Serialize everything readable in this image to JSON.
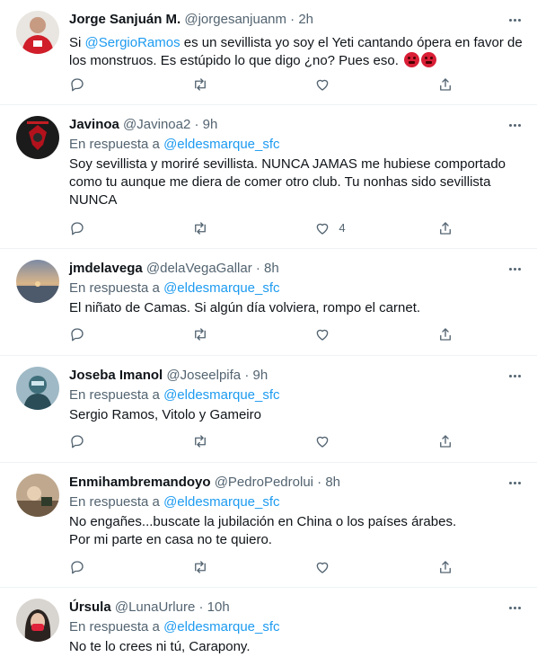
{
  "tweets": [
    {
      "name": "Jorge Sanjuán M.",
      "handle": "@jorgesanjuanm",
      "time": "2h",
      "mention": "@SergioRamos",
      "text": " es un sevillista yo soy el Yeti cantando ópera en favor de los monstruos. Es estúpido lo que digo ¿no? Pues eso. ",
      "text_prefix": "Si ",
      "emojis": [
        "angry-face-icon",
        "cursing-face-icon"
      ],
      "likes": ""
    },
    {
      "name": "Javinoa",
      "handle": "@Javinoa2",
      "time": "9h",
      "replying_label": "En respuesta a",
      "replying_to": "@eldesmarque_sfc",
      "text": "Soy sevillista y moriré sevillista.  NUNCA JAMAS me hubiese comportado como tu aunque me diera de comer otro club.  Tu nonhas sido sevillista NUNCA",
      "likes": "4"
    },
    {
      "name": "jmdelavega",
      "handle": "@delaVegaGallar",
      "time": "8h",
      "replying_label": "En respuesta a",
      "replying_to": "@eldesmarque_sfc",
      "text": "El niñato de Camas. Si algún día volviera, rompo el carnet.",
      "likes": ""
    },
    {
      "name": "Joseba Imanol",
      "handle": "@Joseelpifa",
      "time": "9h",
      "replying_label": "En respuesta a",
      "replying_to": "@eldesmarque_sfc",
      "text": "Sergio Ramos, Vitolo y Gameiro",
      "likes": ""
    },
    {
      "name": "Enmihambremandoyo",
      "handle": "@PedroPedrolui",
      "time": "8h",
      "replying_label": "En respuesta a",
      "replying_to": "@eldesmarque_sfc",
      "text": "No engañes...buscate la jubilación en China o los países árabes.\nPor mi parte en casa no te quiero.",
      "likes": ""
    },
    {
      "name": "Úrsula",
      "handle": "@LunaUrlure",
      "time": "10h",
      "replying_label": "En respuesta a",
      "replying_to": "@eldesmarque_sfc",
      "text": "No te lo crees ni tú, Carapony.",
      "likes": ""
    }
  ],
  "separator": "·",
  "colors": {
    "link": "#1d9bf0",
    "secondary": "#536471",
    "text": "#0f1419",
    "border": "#eff3f4"
  }
}
